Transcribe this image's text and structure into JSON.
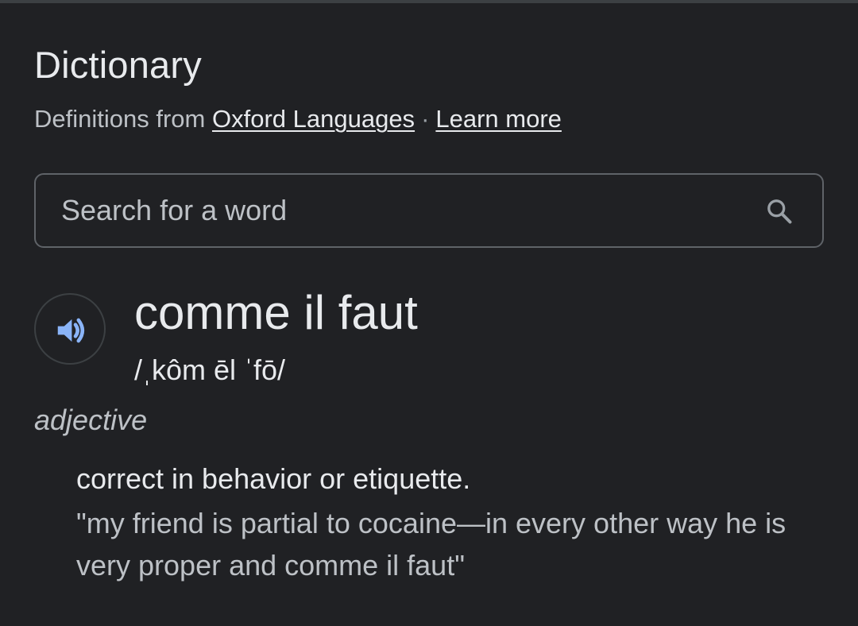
{
  "dictionary": {
    "title": "Dictionary",
    "source_prefix": "Definitions from",
    "source_link": "Oxford Languages",
    "separator": "·",
    "learn_more": "Learn more"
  },
  "search": {
    "placeholder": "Search for a word",
    "value": "",
    "icon": "search-icon"
  },
  "entry": {
    "audio_icon": "speaker-icon",
    "headword": "comme il faut",
    "pronunciation": "/ˌkôm ēl ˈfō/",
    "part_of_speech": "adjective",
    "definition": "correct in behavior or etiquette.",
    "example": "\"my friend is partial to cocaine—in every other way he is very proper and comme il faut\""
  },
  "colors": {
    "background": "#202124",
    "text_primary": "#e8eaed",
    "text_secondary": "#bdc1c6",
    "border": "#5f6368",
    "accent_blue": "#8ab4f8"
  }
}
